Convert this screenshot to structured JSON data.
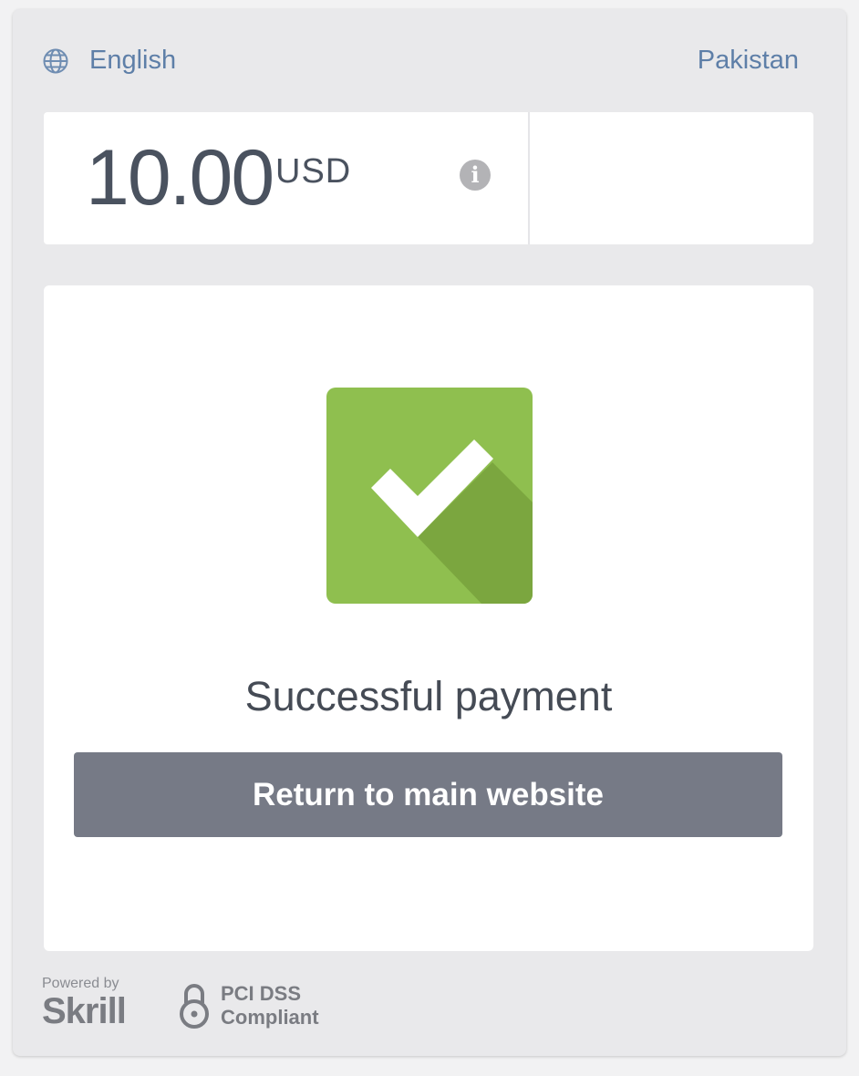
{
  "header": {
    "language_label": "English",
    "country_label": "Pakistan",
    "globe_icon": "globe-icon"
  },
  "amount": {
    "value": "10.00",
    "currency": "USD",
    "info_icon_glyph": "i"
  },
  "result": {
    "status_icon": "checkmark-icon",
    "status_color": "#8fbf4f",
    "message": "Successful payment",
    "return_button_label": "Return to main website"
  },
  "footer": {
    "powered_by": "Powered by",
    "brand_name": "Skrill",
    "pci_line1": "PCI DSS",
    "pci_line2": "Compliant",
    "lock_icon": "lock-icon"
  },
  "colors": {
    "link": "#5e7fa8",
    "button_bg": "#767a86",
    "success_green": "#8fbf4f"
  }
}
